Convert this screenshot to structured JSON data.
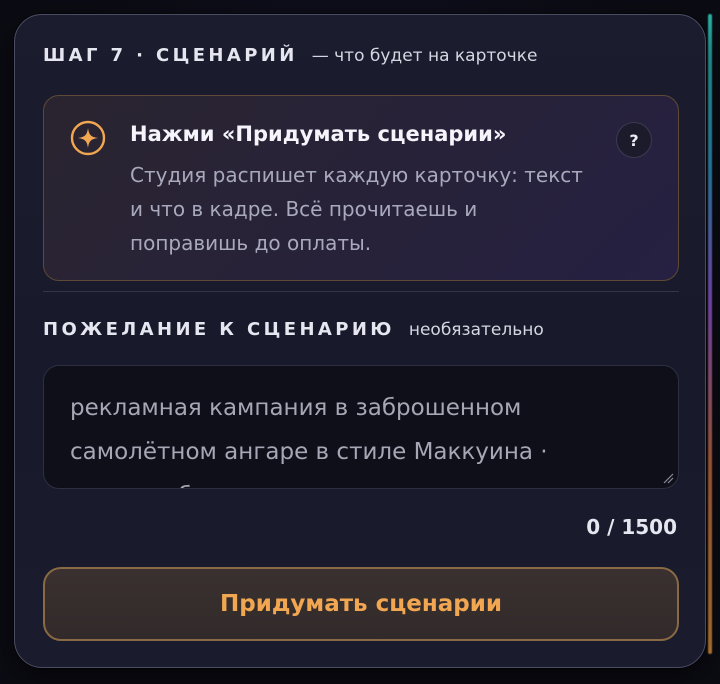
{
  "step": {
    "title": "ШАГ 7 · СЦЕНАРИЙ",
    "subtitle": "— что будет на карточке"
  },
  "hint": {
    "icon": "sparkle-icon",
    "title": "Нажми «Придумать сценарии»",
    "body": "Студия распишет каждую карточку: текст и что в кадре. Всё прочитаешь и поправишь до оплаты.",
    "help_label": "?"
  },
  "wish": {
    "title": "ПОЖЕЛАНИЕ К СЦЕНАРИЮ",
    "subtitle": "необязательно",
    "placeholder": "рекламная кампания в заброшенном самолётном ангаре в стиле Маккуина · продукт без гравитации, дерзкие"
  },
  "counter": "0 / 1500",
  "cta": {
    "label": "Придумать сценарии"
  },
  "colors": {
    "accent": "#f1a652",
    "hint_border": "#5e4a35",
    "card_bg": "#1b1c2e"
  }
}
